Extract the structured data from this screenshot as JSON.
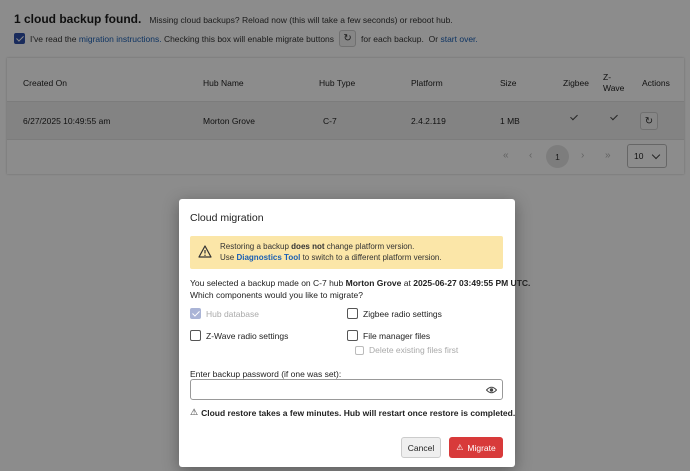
{
  "header": {
    "title": "1 cloud backup found.",
    "missing_text": "Missing cloud backups?",
    "reload_link": "Reload now",
    "reload_suffix": "(this will take a few seconds) or",
    "reboot_link": "reboot hub."
  },
  "consent": {
    "checked": true,
    "prefix": "I've read the",
    "instructions_link": "migration instructions.",
    "middle": "Checking this box will enable migrate buttons",
    "suffix": "for each backup.",
    "or_text": "Or",
    "start_over_link": "start over.",
    "migrate_icon": "restore-icon"
  },
  "table": {
    "columns": [
      "Created On",
      "Hub Name",
      "Hub Type",
      "Platform",
      "Size",
      "Zigbee",
      "Z-\nWave",
      "Actions"
    ],
    "rows": [
      {
        "created_on": "6/27/2025 10:49:55 am",
        "hub_name": "Morton Grove",
        "hub_type": "C-7",
        "platform": "2.4.2.119",
        "size": "1 MB",
        "zigbee": true,
        "zwave": true,
        "action_icon": "restore-icon"
      }
    ]
  },
  "pagination": {
    "first": "«",
    "prev": "‹",
    "current_page": "1",
    "next": "›",
    "last": "»",
    "page_size": "10"
  },
  "modal": {
    "title": "Cloud migration",
    "warning": {
      "line1_prefix": "Restoring a backup",
      "line1_bold": "does not",
      "line1_suffix": "change platform version.",
      "line2_prefix": "Use",
      "line2_link": "Diagnostics Tool",
      "line2_suffix": "to switch to a different platform version."
    },
    "info_prefix": "You selected a backup made on C-7 hub",
    "info_hub": "Morton Grove",
    "info_at": "at",
    "info_date": "2025-06-27 03:49:55 PM UTC.",
    "question": "Which components would you like to migrate?",
    "options": {
      "hub_database": {
        "label": "Hub database",
        "checked": true,
        "disabled": true
      },
      "zigbee": {
        "label": "Zigbee radio settings",
        "checked": false,
        "disabled": false
      },
      "zwave": {
        "label": "Z-Wave radio settings",
        "checked": false,
        "disabled": false
      },
      "file_manager": {
        "label": "File manager files",
        "checked": false,
        "disabled": false
      },
      "delete_existing": {
        "label": "Delete existing files first",
        "checked": false,
        "disabled": true
      }
    },
    "password_label": "Enter backup password (if one was set):",
    "password_value": "",
    "restore_note": "Cloud restore takes a few minutes. Hub will restart once restore is completed.",
    "cancel_label": "Cancel",
    "migrate_label": "Migrate"
  },
  "colors": {
    "accent": "#2f4fa8",
    "link": "#1a5fb4",
    "warning_bg": "#fbe6a8",
    "danger": "#d83a3a"
  }
}
